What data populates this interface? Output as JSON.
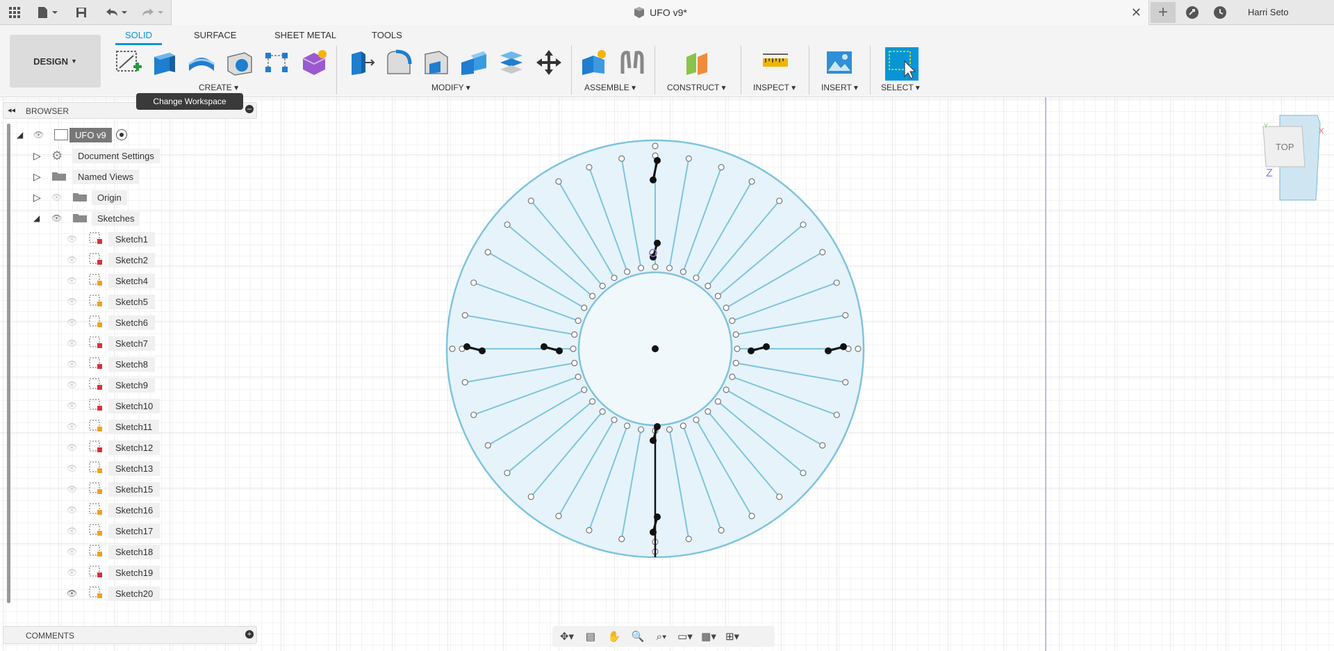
{
  "titlebar": {
    "doc_title": "UFO v9*",
    "user_name": "Harri Seto",
    "icons": [
      "apps-grid-icon",
      "file-icon",
      "save-icon",
      "undo-icon",
      "redo-icon",
      "close-tab-icon",
      "new-tab-icon",
      "job-status-icon",
      "clock-icon"
    ]
  },
  "toolbar": {
    "workspace_button": "DESIGN",
    "tabs": [
      "SOLID",
      "SURFACE",
      "SHEET METAL",
      "TOOLS"
    ],
    "active_tab": "SOLID",
    "groups": [
      "CREATE",
      "MODIFY",
      "ASSEMBLE",
      "CONSTRUCT",
      "INSPECT",
      "INSERT",
      "SELECT"
    ],
    "tooltip": "Change Workspace"
  },
  "browser": {
    "title": "BROWSER",
    "root": "UFO v9",
    "items": [
      "Document Settings",
      "Named Views",
      "Origin",
      "Sketches"
    ],
    "sketches": [
      "Sketch1",
      "Sketch2",
      "Sketch4",
      "Sketch5",
      "Sketch6",
      "Sketch7",
      "Sketch8",
      "Sketch9",
      "Sketch10",
      "Sketch11",
      "Sketch12",
      "Sketch13",
      "Sketch15",
      "Sketch16",
      "Sketch17",
      "Sketch18",
      "Sketch19",
      "Sketch20"
    ],
    "visible_sketch": "Sketch20"
  },
  "comments": {
    "title": "COMMENTS"
  },
  "viewcube": {
    "face": "TOP",
    "axis_x": "X",
    "axis_y": "Y",
    "axis_z": "Z"
  },
  "colors": {
    "accent": "#0696d7",
    "sketch_line": "#7ec4de",
    "sketch_fill": "#e6f3fa",
    "grid": "#e2e2e2"
  }
}
